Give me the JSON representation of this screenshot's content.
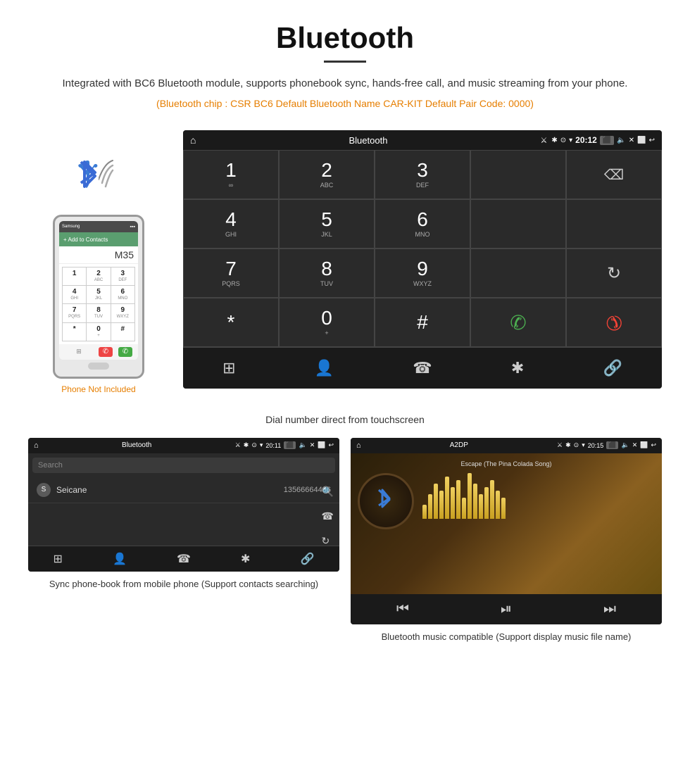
{
  "page": {
    "title": "Bluetooth",
    "description": "Integrated with BC6 Bluetooth module, supports phonebook sync, hands-free call, and music streaming from your phone.",
    "specs": "(Bluetooth chip : CSR BC6    Default Bluetooth Name CAR-KIT    Default Pair Code: 0000)",
    "caption_main": "Dial number direct from touchscreen",
    "caption_left": "Sync phone-book from mobile phone\n(Support contacts searching)",
    "caption_right": "Bluetooth music compatible\n(Support display music file name)"
  },
  "phone_note": "Phone Not Included",
  "status_bar": {
    "title": "Bluetooth",
    "time": "20:12",
    "title2": "A2DP",
    "time2": "20:15"
  },
  "dialpad": {
    "keys": [
      {
        "digit": "1",
        "letters": "∞"
      },
      {
        "digit": "2",
        "letters": "ABC"
      },
      {
        "digit": "3",
        "letters": "DEF"
      },
      {
        "digit": "",
        "letters": ""
      },
      {
        "digit": "⌫",
        "letters": ""
      },
      {
        "digit": "4",
        "letters": "GHI"
      },
      {
        "digit": "5",
        "letters": "JKL"
      },
      {
        "digit": "6",
        "letters": "MNO"
      },
      {
        "digit": "",
        "letters": ""
      },
      {
        "digit": "",
        "letters": ""
      },
      {
        "digit": "7",
        "letters": "PQRS"
      },
      {
        "digit": "8",
        "letters": "TUV"
      },
      {
        "digit": "9",
        "letters": "WXYZ"
      },
      {
        "digit": "",
        "letters": ""
      },
      {
        "digit": "↺",
        "letters": ""
      },
      {
        "digit": "*",
        "letters": ""
      },
      {
        "digit": "0",
        "letters": "+"
      },
      {
        "digit": "#",
        "letters": ""
      },
      {
        "digit": "📞",
        "letters": "green"
      },
      {
        "digit": "📵",
        "letters": "red"
      }
    ],
    "bottom_nav": [
      "⊞",
      "👤",
      "📞",
      "✱",
      "🔗"
    ]
  },
  "phonebook": {
    "search_placeholder": "Search",
    "contact": {
      "letter": "S",
      "name": "Seicane",
      "phone": "13566664466"
    }
  },
  "music": {
    "song_title": "Escape (The Pina Colada Song)",
    "eq_bars": [
      20,
      35,
      50,
      40,
      60,
      45,
      55,
      30,
      65,
      50,
      35,
      45,
      55,
      40,
      30
    ]
  }
}
